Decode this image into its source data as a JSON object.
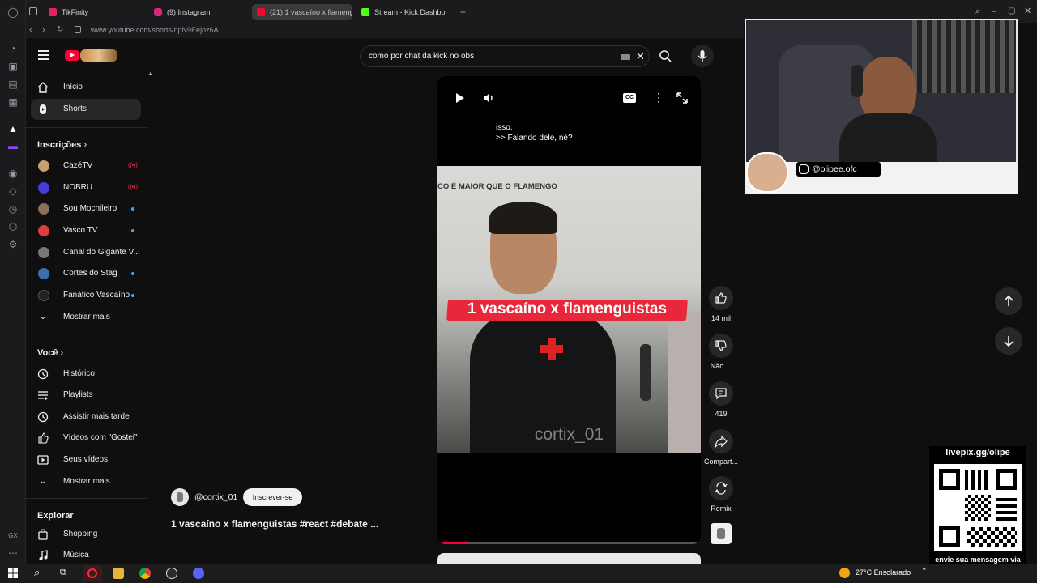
{
  "browser": {
    "tabs": [
      {
        "label": "TikFinity",
        "color": "#e0245e"
      },
      {
        "label": "(9) Instagram",
        "color": "#d62976"
      },
      {
        "label": "(21) 1 vascaíno x flamengu",
        "color": "#ff0033"
      },
      {
        "label": "Stream - Kick Dashbo",
        "color": "#53fc18"
      }
    ],
    "url": "www.youtube.com/shorts/npN9Eejoz6A"
  },
  "header": {
    "search_value": "como por chat da kick no obs"
  },
  "sidebar": {
    "main": [
      {
        "label": "Início",
        "icon": "home-icon"
      },
      {
        "label": "Shorts",
        "icon": "shorts-icon"
      }
    ],
    "subscriptions_title": "Inscrições",
    "subscriptions": [
      {
        "label": "CazéTV",
        "live": "red",
        "avatar": "#c8a06a"
      },
      {
        "label": "NOBRU",
        "live": "red",
        "avatar": "#4a3ad9"
      },
      {
        "label": "Sou Mochileiro",
        "live": "blue",
        "avatar": "#8a6f5a"
      },
      {
        "label": "Vasco TV",
        "live": "blue",
        "avatar": "#e03c3c"
      },
      {
        "label": "Canal do Gigante V...",
        "live": "blue",
        "avatar": "#777777"
      },
      {
        "label": "Cortes do Stag",
        "live": "blue",
        "avatar": "#3a6fb0"
      },
      {
        "label": "Fanático Vascaíno",
        "live": "blue",
        "avatar": "#222222"
      }
    ],
    "subs_more": "Mostrar mais",
    "you_title": "Você",
    "you": [
      {
        "label": "Histórico",
        "icon": "history-icon"
      },
      {
        "label": "Playlists",
        "icon": "playlist-icon"
      },
      {
        "label": "Assistir mais tarde",
        "icon": "clock-icon"
      },
      {
        "label": "Vídeos com \"Gostei\"",
        "icon": "like-icon"
      },
      {
        "label": "Seus vídeos",
        "icon": "video-icon"
      }
    ],
    "you_more": "Mostrar mais",
    "explore_title": "Explorar",
    "explore": [
      {
        "label": "Shopping",
        "icon": "shopping-icon"
      },
      {
        "label": "Música",
        "icon": "music-icon"
      }
    ]
  },
  "player": {
    "caption_line1": "isso.",
    "caption_line2": ">> Falando dele, né?",
    "video_top_text": "CO É MAIOR QUE O FLAMENGO",
    "video_banner": "1 vascaíno x flamenguistas",
    "watermark": "cortix_01",
    "progress": 0.1
  },
  "actions": {
    "likes": "14 mil",
    "dislike": "Não ...",
    "comments": "419",
    "share": "Compart...",
    "remix": "Remix"
  },
  "channel": {
    "handle": "@cortix_01",
    "subscribe": "Inscrever-se",
    "title": "1 vascaíno x flamenguistas #react #debate ..."
  },
  "overlay": {
    "instagram_handle": "@olipee.ofc",
    "qr_url": "livepix.gg/olipe",
    "qr_caption": "envie sua mensagem via live pix"
  },
  "taskbar": {
    "weather": "27°C  Ensolarado"
  }
}
